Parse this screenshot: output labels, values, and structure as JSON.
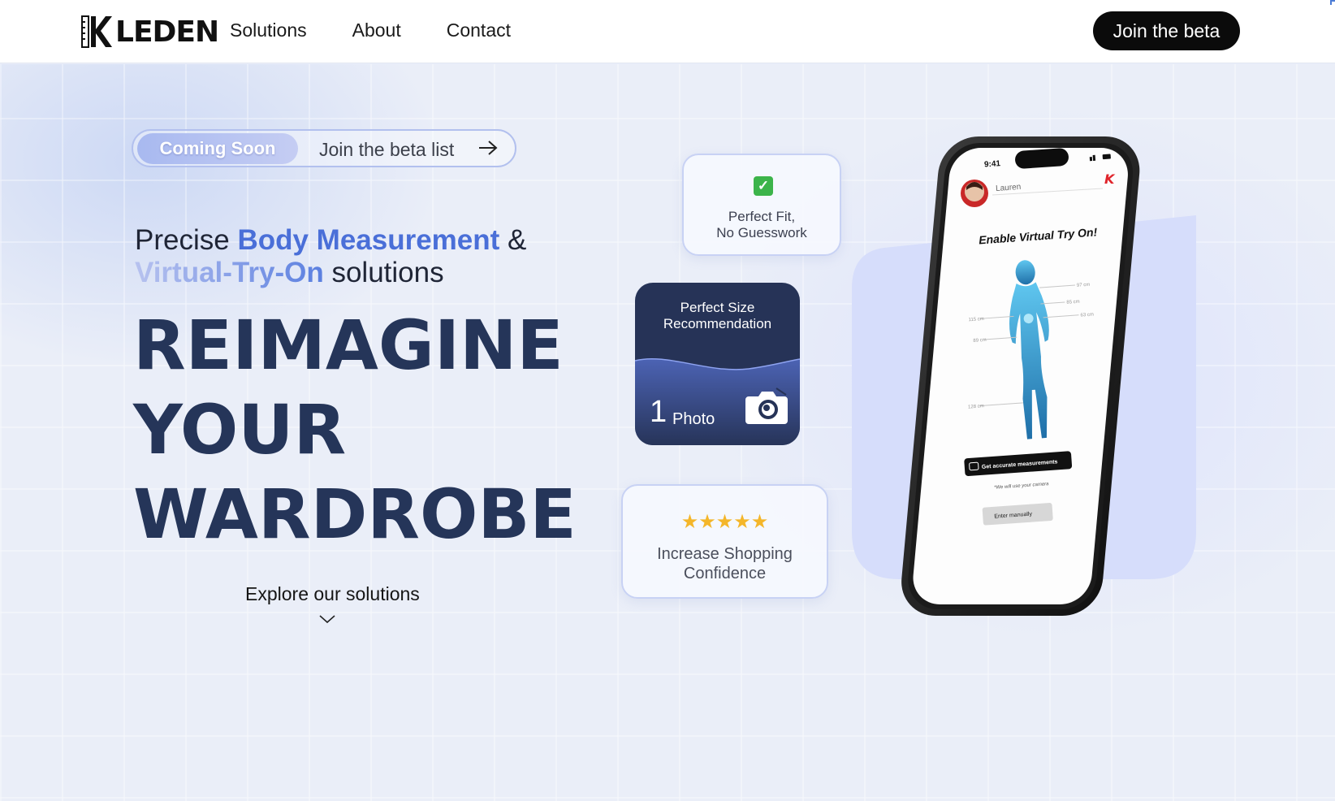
{
  "nav": {
    "logo": "LEDEN",
    "links": [
      "Solutions",
      "About",
      "Contact"
    ],
    "cta": "Join the beta"
  },
  "hero": {
    "badge": "Coming Soon",
    "pill_label": "Join the beta list",
    "tagline": {
      "part1": "Precise ",
      "part2": "Body Measurement",
      "part3": " &",
      "part4": "Virtual-Try-On",
      "part5": " solutions"
    },
    "headline": [
      "REIMAGINE",
      "YOUR",
      "WARDROBE"
    ],
    "explore": "Explore our solutions"
  },
  "cards": {
    "fit": {
      "line1": "Perfect Fit,",
      "line2": "No Guesswork"
    },
    "size": {
      "line1": "Perfect Size",
      "line2": "Recommendation",
      "count": "1",
      "count_label": "Photo"
    },
    "confidence": {
      "stars": "★★★★★",
      "line1": "Increase Shopping",
      "line2": "Confidence"
    }
  },
  "phone": {
    "time": "9:41",
    "user": "Lauren",
    "title": "Enable Virtual Try On!",
    "measurements": [
      "97 cm",
      "85 cm",
      "63 cm",
      "115 cm",
      "89 cm",
      "128 cm"
    ],
    "primary_button": "Get accurate measurements",
    "note": "*We will use your camera",
    "secondary_button": "Enter manually"
  },
  "colors": {
    "accent": "#4a6fd8",
    "navy": "#253559",
    "card_dark": "#263357",
    "lavender": "#d6ddfb"
  }
}
